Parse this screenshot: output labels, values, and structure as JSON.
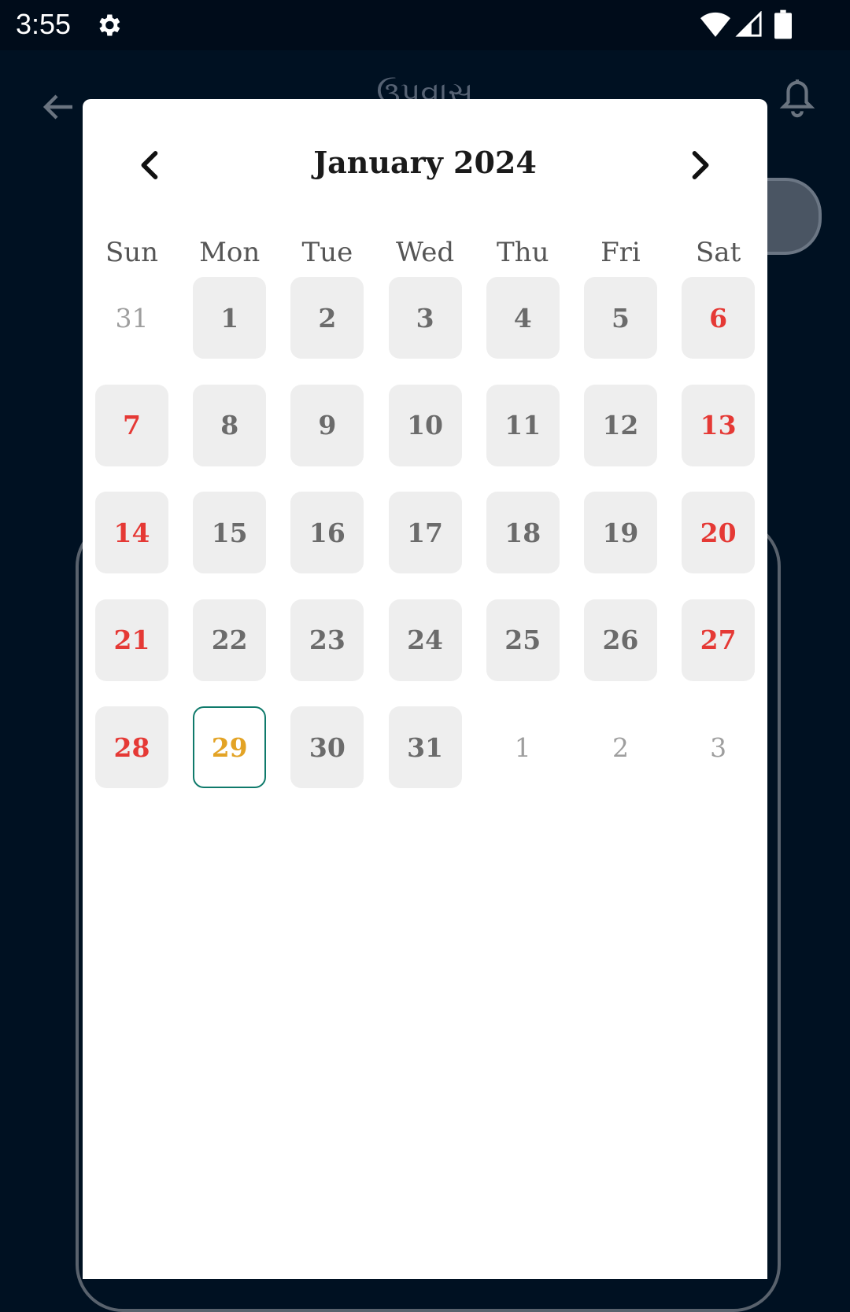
{
  "status_bar": {
    "time": "3:55",
    "icons": [
      "gear-icon",
      "wifi-icon",
      "signal-icon",
      "battery-icon"
    ]
  },
  "app_bar": {
    "title": "ઉપવાસ",
    "back_icon": "arrow-left-icon",
    "bell_icon": "bell-icon"
  },
  "calendar": {
    "month_title": "January 2024",
    "prev_icon": "chevron-left-icon",
    "next_icon": "chevron-right-icon",
    "weekdays": [
      "Sun",
      "Mon",
      "Tue",
      "Wed",
      "Thu",
      "Fri",
      "Sat"
    ],
    "days": [
      {
        "label": "31",
        "kind": "other"
      },
      {
        "label": "1",
        "kind": "current"
      },
      {
        "label": "2",
        "kind": "current"
      },
      {
        "label": "3",
        "kind": "current"
      },
      {
        "label": "4",
        "kind": "current"
      },
      {
        "label": "5",
        "kind": "current"
      },
      {
        "label": "6",
        "kind": "weekend"
      },
      {
        "label": "7",
        "kind": "weekend"
      },
      {
        "label": "8",
        "kind": "current"
      },
      {
        "label": "9",
        "kind": "current"
      },
      {
        "label": "10",
        "kind": "current"
      },
      {
        "label": "11",
        "kind": "current"
      },
      {
        "label": "12",
        "kind": "current"
      },
      {
        "label": "13",
        "kind": "weekend"
      },
      {
        "label": "14",
        "kind": "weekend"
      },
      {
        "label": "15",
        "kind": "current"
      },
      {
        "label": "16",
        "kind": "current"
      },
      {
        "label": "17",
        "kind": "current"
      },
      {
        "label": "18",
        "kind": "current"
      },
      {
        "label": "19",
        "kind": "current"
      },
      {
        "label": "20",
        "kind": "weekend"
      },
      {
        "label": "21",
        "kind": "weekend"
      },
      {
        "label": "22",
        "kind": "current"
      },
      {
        "label": "23",
        "kind": "current"
      },
      {
        "label": "24",
        "kind": "current"
      },
      {
        "label": "25",
        "kind": "current"
      },
      {
        "label": "26",
        "kind": "current"
      },
      {
        "label": "27",
        "kind": "weekend"
      },
      {
        "label": "28",
        "kind": "weekend"
      },
      {
        "label": "29",
        "kind": "today"
      },
      {
        "label": "30",
        "kind": "current"
      },
      {
        "label": "31",
        "kind": "current"
      },
      {
        "label": "1",
        "kind": "other"
      },
      {
        "label": "2",
        "kind": "other"
      },
      {
        "label": "3",
        "kind": "other"
      }
    ],
    "colors": {
      "weekend": "#e53935",
      "today_text": "#e3a325",
      "today_border": "#0f7a6b",
      "cell_bg": "#eeeeee"
    }
  }
}
